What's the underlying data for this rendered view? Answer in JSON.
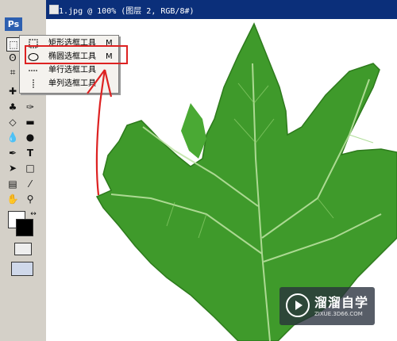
{
  "app": {
    "badge": "Ps"
  },
  "document": {
    "title": "1.jpg @ 100% (图层 2, RGB/8#)"
  },
  "tool_menu": {
    "items": [
      {
        "label": "矩形选框工具",
        "shortcut": "M",
        "icon": "rect-marquee-icon"
      },
      {
        "label": "椭圆选框工具",
        "shortcut": "M",
        "icon": "ellipse-marquee-icon",
        "highlighted": true
      },
      {
        "label": "单行选框工具",
        "shortcut": "",
        "icon": "row-marquee-icon"
      },
      {
        "label": "单列选框工具",
        "shortcut": "",
        "icon": "column-marquee-icon"
      }
    ]
  },
  "watermark": {
    "title": "溜溜自学",
    "url": "ZIXUE.3D66.COM"
  },
  "colors": {
    "annotation": "#d22222",
    "leaf": "#3f9a2b",
    "titlebar": "#0b2f7a"
  }
}
